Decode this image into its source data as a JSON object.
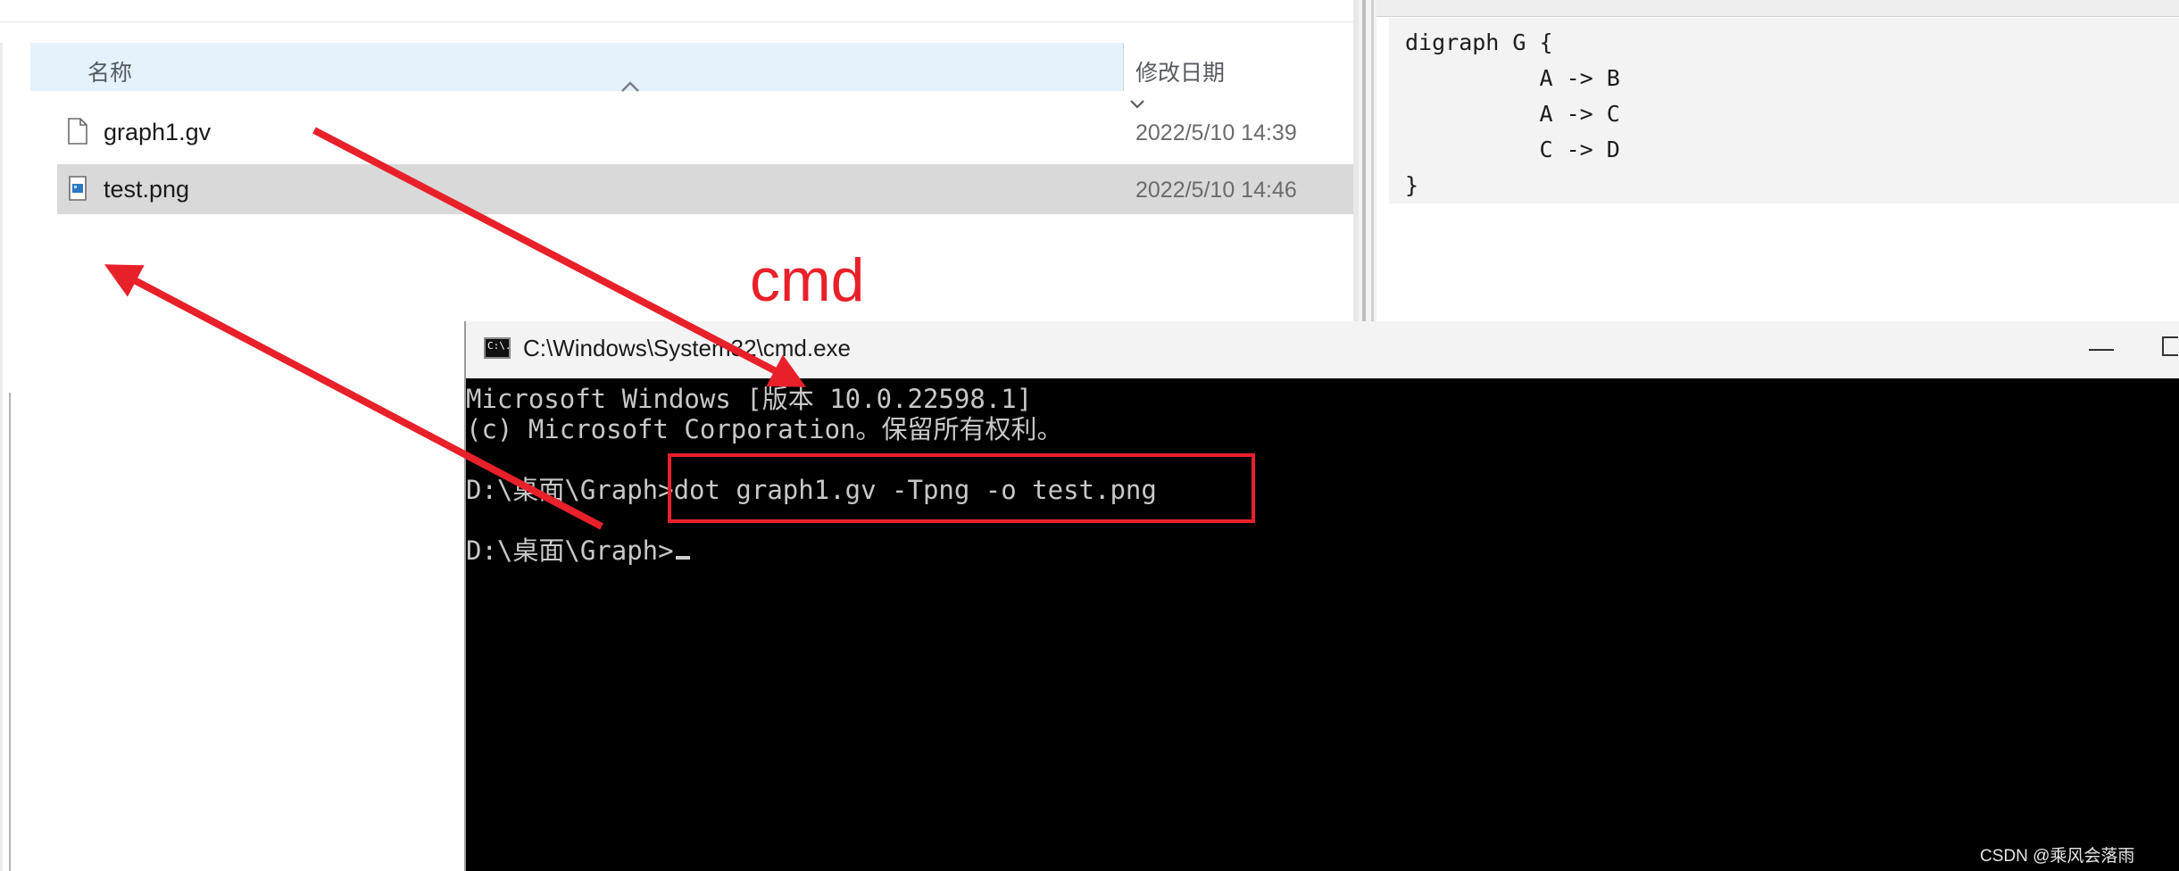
{
  "explorer": {
    "columns": {
      "name": "名称",
      "modified": "修改日期"
    },
    "files": [
      {
        "name": "graph1.gv",
        "date": "2022/5/10 14:39",
        "icon": "document-icon",
        "selected": false
      },
      {
        "name": "test.png",
        "date": "2022/5/10 14:46",
        "icon": "image-file-icon",
        "selected": true
      }
    ]
  },
  "editor": {
    "code": "digraph G {\n          A -> B\n          A -> C\n          C -> D\n}"
  },
  "cmd_window": {
    "title": "C:\\Windows\\System32\\cmd.exe",
    "icon_text": "C:\\.",
    "minimize_glyph": "—",
    "lines": [
      "Microsoft Windows [版本 10.0.22598.1]",
      "(c) Microsoft Corporation。保留所有权利。",
      "D:\\桌面\\Graph>dot graph1.gv -Tpng -o test.png",
      "D:\\桌面\\Graph>"
    ]
  },
  "annotations": {
    "label": "cmd",
    "color": "#e8202a"
  },
  "watermark": "CSDN @乘风会落雨"
}
